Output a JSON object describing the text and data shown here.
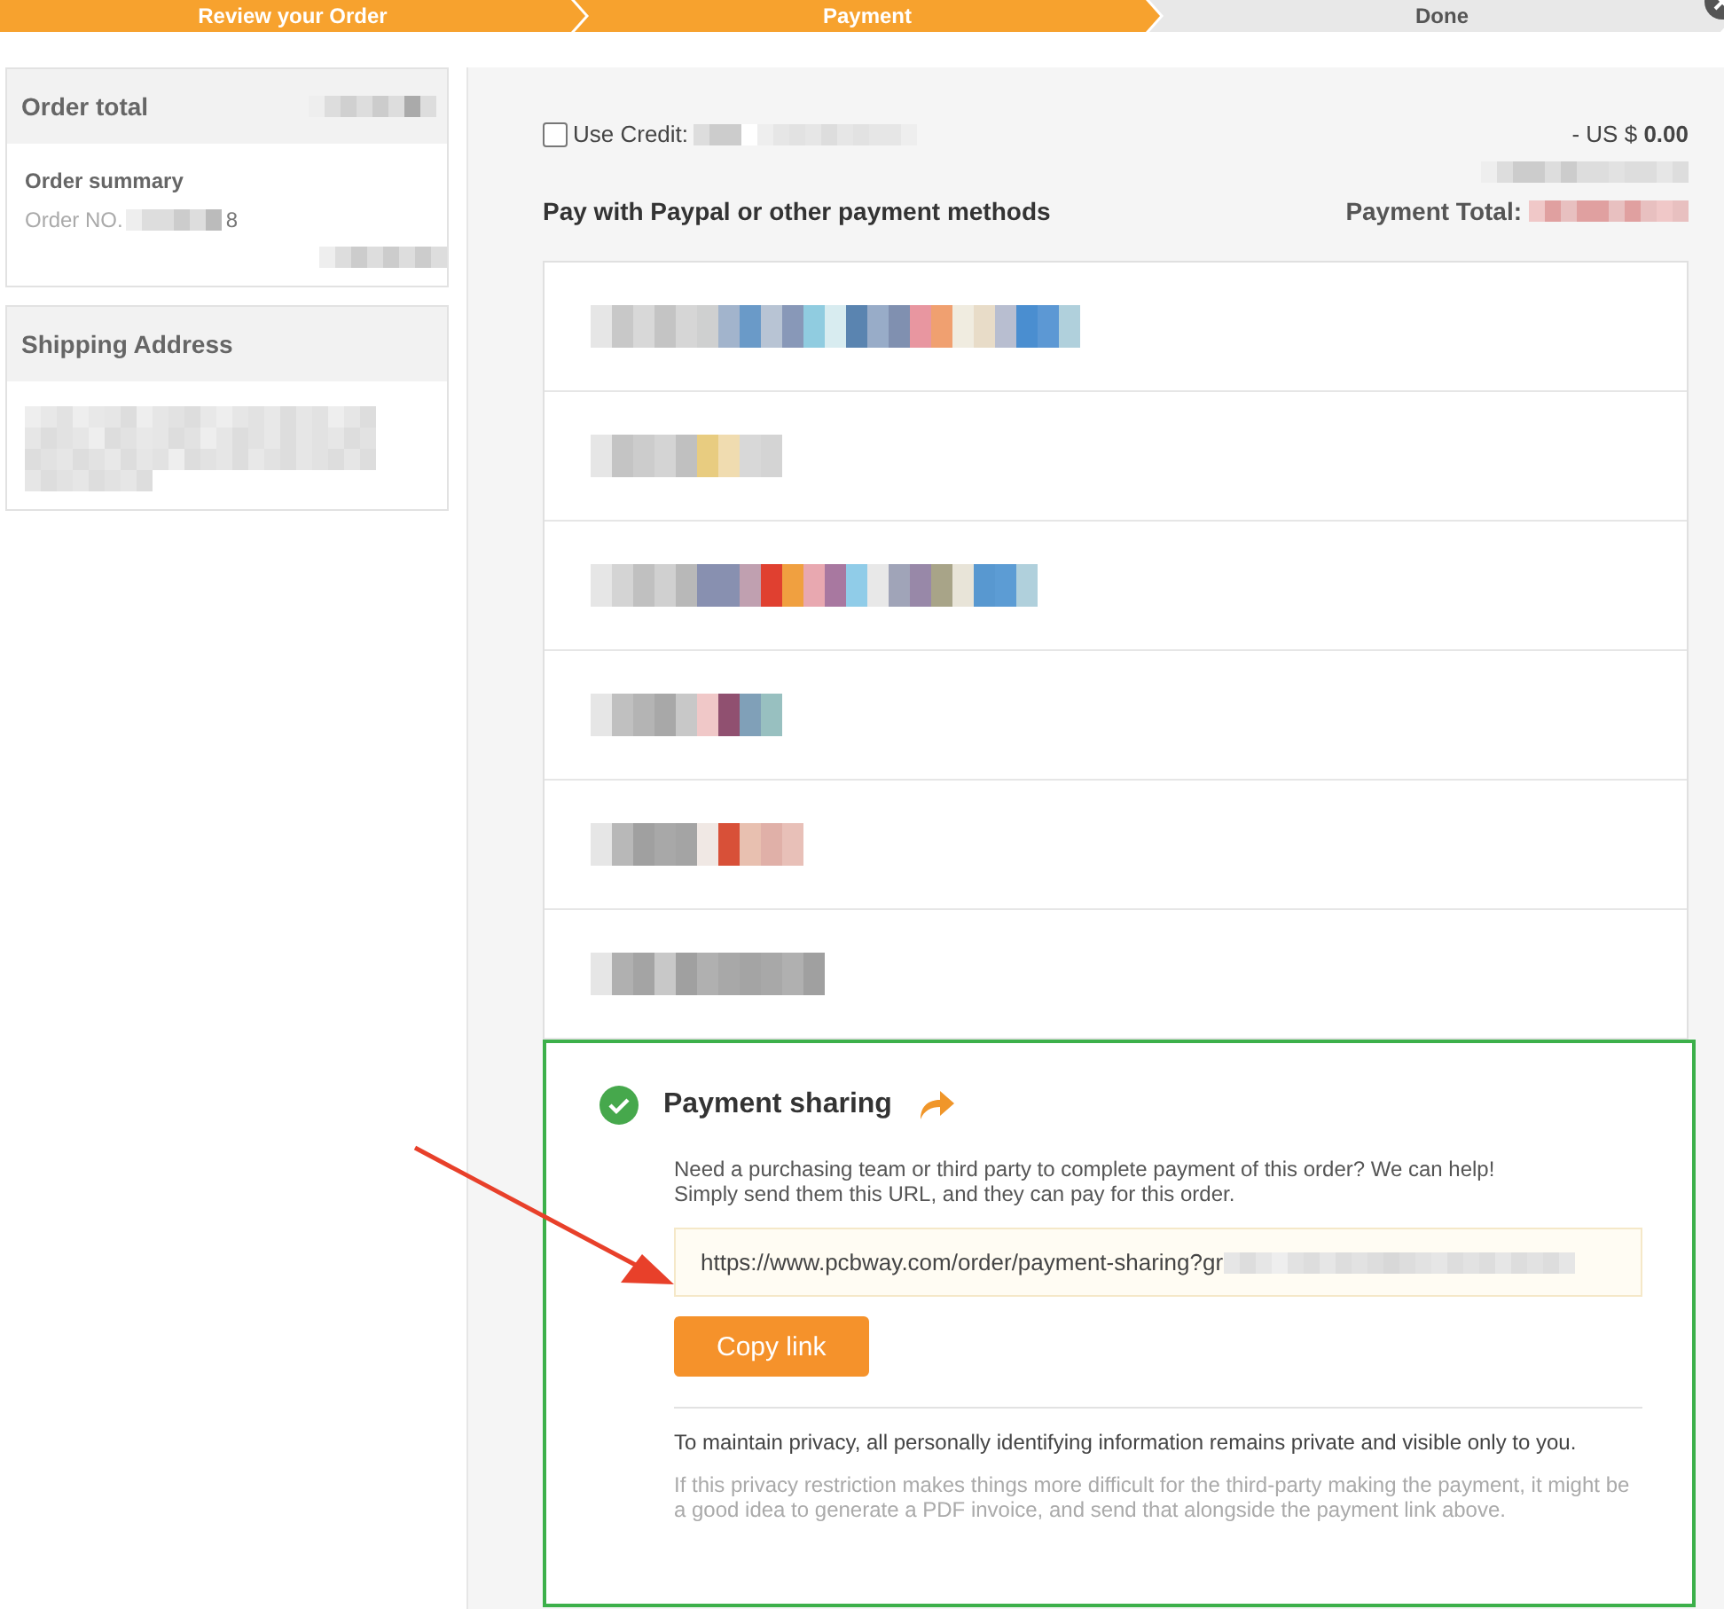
{
  "steps": [
    {
      "label": "Review your Order",
      "active": true
    },
    {
      "label": "Payment",
      "active": true
    },
    {
      "label": "Done",
      "active": false
    }
  ],
  "sidebar": {
    "order_total": {
      "title": "Order total"
    },
    "order_summary": {
      "title": "Order summary",
      "order_no_label": "Order NO.",
      "order_no_end": "8"
    },
    "shipping": {
      "title": "Shipping Address"
    }
  },
  "credit": {
    "label": "Use Credit:",
    "checked": false,
    "amount_prefix": "- US $",
    "amount": "0.00"
  },
  "pay_heading": "Pay with Paypal or other payment methods",
  "payment_total_label": "Payment Total:",
  "payment_options": [
    {
      "kind": "redacted"
    },
    {
      "kind": "redacted"
    },
    {
      "kind": "redacted"
    },
    {
      "kind": "redacted"
    },
    {
      "kind": "redacted"
    },
    {
      "kind": "redacted"
    }
  ],
  "sharing": {
    "title": "Payment sharing",
    "enabled": true,
    "description": "Need a purchasing team or third party to complete payment of this order? We can help!\nSimply send them this URL, and they can pay for this order.",
    "url": "https://www.pcbway.com/order/payment-sharing?gr",
    "button": "Copy link",
    "privacy": "To maintain privacy, all personally identifying information remains private and visible only to you.",
    "note": "If this privacy restriction makes things more difficult for the third-party making the payment, it might be a good idea to generate a PDF invoice, and send that alongside the payment link above."
  }
}
